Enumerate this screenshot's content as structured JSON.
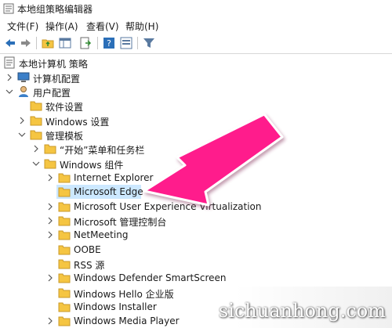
{
  "window": {
    "title": "本地组策略编辑器"
  },
  "menu": [
    {
      "label": "文件(F)"
    },
    {
      "label": "操作(A)"
    },
    {
      "label": "查看(V)"
    },
    {
      "label": "帮助(H)"
    }
  ],
  "toolbar": {
    "buttons": [
      "back-icon",
      "forward-icon",
      "up-folder-icon",
      "console-tree-icon",
      "export-list-icon",
      "help-icon",
      "properties-icon",
      "filter-icon"
    ]
  },
  "tree": {
    "root": "本地计算机 策略",
    "computer_config": "计算机配置",
    "user_config": "用户配置",
    "software_settings": "软件设置",
    "windows_settings": "Windows 设置",
    "admin_templates": "管理模板",
    "start_menu": "“开始”菜单和任务栏",
    "windows_components": "Windows 组件",
    "items": [
      "Internet Explorer",
      "Microsoft Edge",
      "Microsoft User Experience Virtualization",
      "Microsoft 管理控制台",
      "NetMeeting",
      "OOBE",
      "RSS 源",
      "Windows Defender SmartScreen",
      "Windows Hello 企业版",
      "Windows Installer",
      "Windows Media Player"
    ]
  },
  "watermark": "sichuanhong.com",
  "colors": {
    "arrow": "#ff1a8c",
    "folder": "#f5c542",
    "selection": "#cce8ff"
  }
}
